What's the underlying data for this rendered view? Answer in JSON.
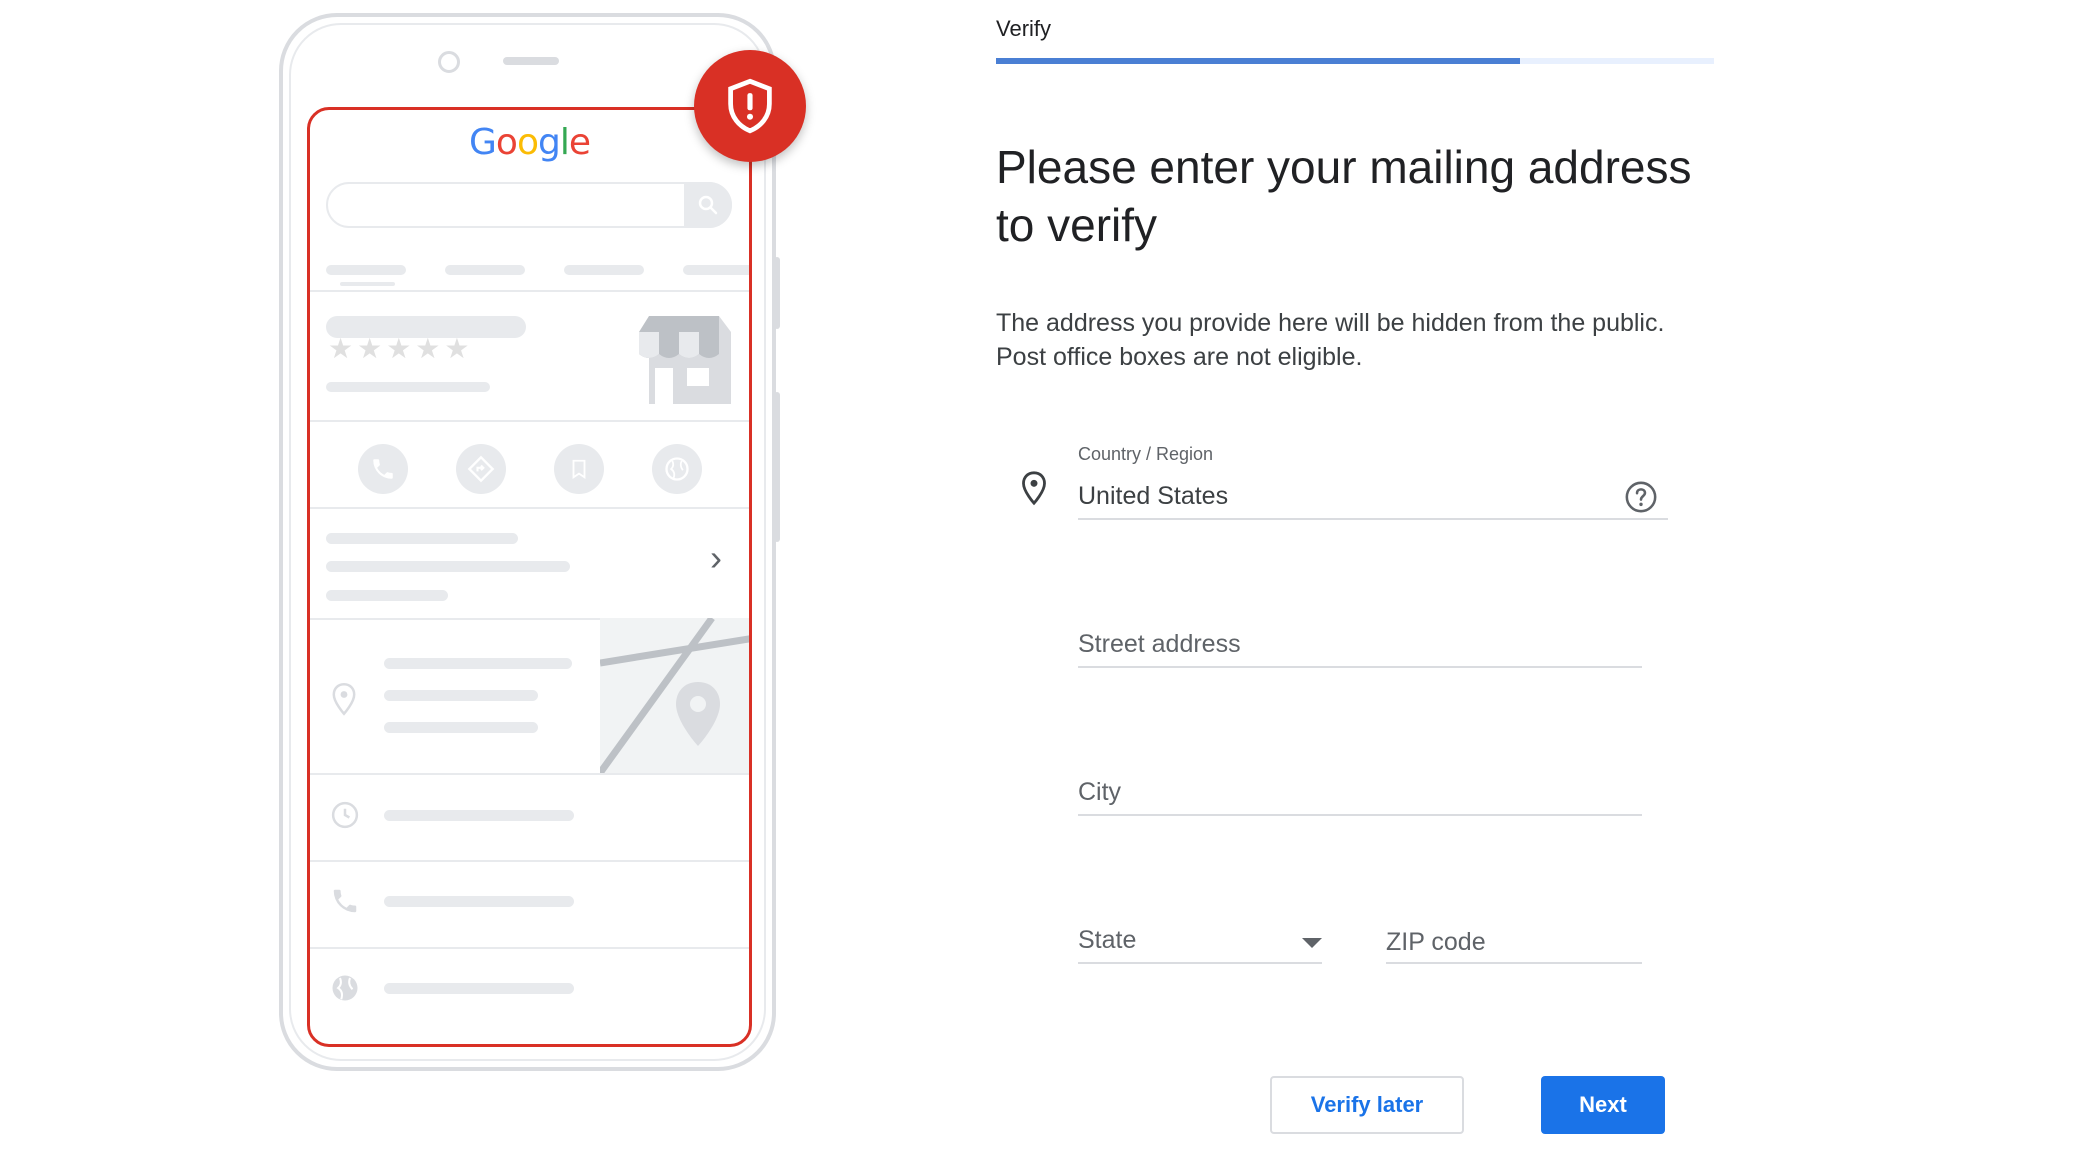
{
  "brand": {
    "logo_letters": [
      {
        "ch": "G",
        "color": "#4285F4"
      },
      {
        "ch": "o",
        "color": "#EA4335"
      },
      {
        "ch": "o",
        "color": "#FBBC05"
      },
      {
        "ch": "g",
        "color": "#4285F4"
      },
      {
        "ch": "l",
        "color": "#34A853"
      },
      {
        "ch": "e",
        "color": "#EA4335"
      }
    ]
  },
  "illustration": {
    "rating_stars": "★★★★★",
    "chevron": "›"
  },
  "stepper": {
    "label": "Verify",
    "progress": 0.73
  },
  "form": {
    "title": "Please enter your mailing address to verify",
    "description": "The address you provide here will be hidden from the public. Post office boxes are not eligible.",
    "country_label": "Country / Region",
    "country_value": "United States",
    "street_placeholder": "Street address",
    "city_placeholder": "City",
    "state_placeholder": "State",
    "zip_placeholder": "ZIP code"
  },
  "actions": {
    "verify_later": "Verify later",
    "next": "Next"
  },
  "colors": {
    "accent": "#1a73e8",
    "alert_red": "#d93025",
    "progress_blue": "#4a7fd4"
  }
}
